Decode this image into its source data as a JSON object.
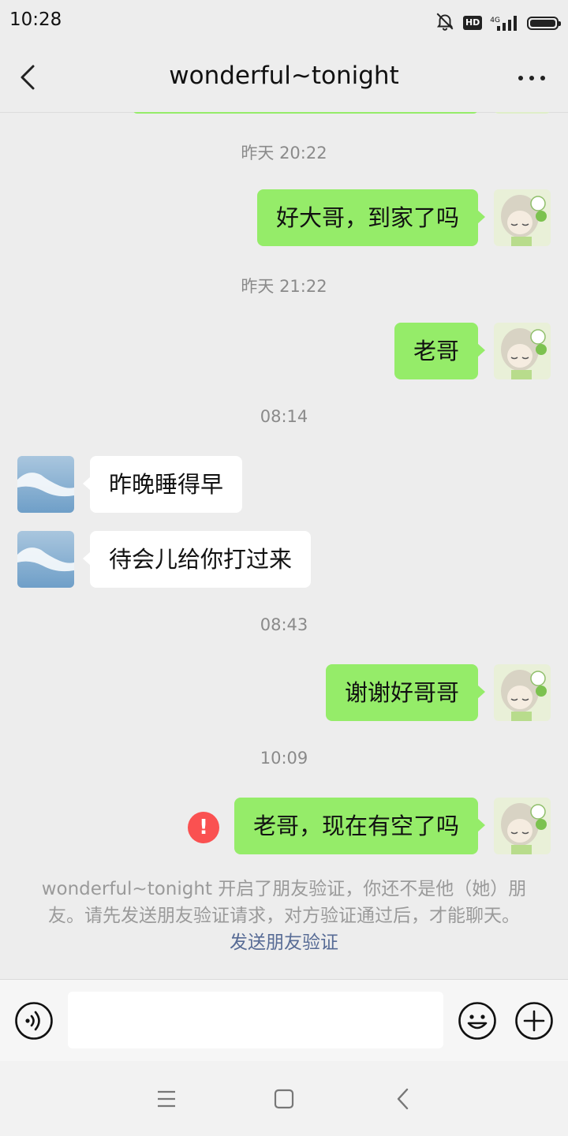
{
  "status_bar": {
    "time": "10:28",
    "hd_badge": "HD",
    "network": "4G",
    "icons": [
      "mute-bell-icon",
      "hd-icon",
      "signal-icon",
      "battery-icon"
    ]
  },
  "header": {
    "title": "wonderful~tonight",
    "back_icon": "chevron-left-icon",
    "more_icon": "more-dots-icon"
  },
  "messages": [
    {
      "timestamp": "昨天 20:22"
    },
    {
      "sender": "me",
      "text": "好大哥，到家了吗"
    },
    {
      "timestamp": "昨天 21:22"
    },
    {
      "sender": "me",
      "text": "老哥"
    },
    {
      "timestamp": "08:14"
    },
    {
      "sender": "friend",
      "text": "昨晚睡得早"
    },
    {
      "sender": "friend",
      "text": "待会儿给你打过来"
    },
    {
      "timestamp": "08:43"
    },
    {
      "sender": "me",
      "text": "谢谢好哥哥"
    },
    {
      "timestamp": "10:09"
    },
    {
      "sender": "me",
      "text": "老哥，现在有空了吗",
      "failed": true,
      "failed_mark": "!"
    }
  ],
  "system_notice": {
    "text": "wonderful~tonight 开启了朋友验证，你还不是他（她）朋友。请先发送朋友验证请求，对方验证通过后，才能聊天。",
    "link_text": "发送朋友验证"
  },
  "input_bar": {
    "value": "",
    "placeholder": "",
    "voice_icon": "voice-icon",
    "emoji_icon": "emoji-icon",
    "plus_icon": "plus-icon"
  },
  "system_nav": [
    "menu-icon",
    "home-icon",
    "back-icon"
  ],
  "colors": {
    "background": "#ededed",
    "my_bubble": "#95ec69",
    "friend_bubble": "#ffffff",
    "error_badge": "#fa5151",
    "link": "#576b95",
    "timestamp_text": "#8a8a8a"
  }
}
